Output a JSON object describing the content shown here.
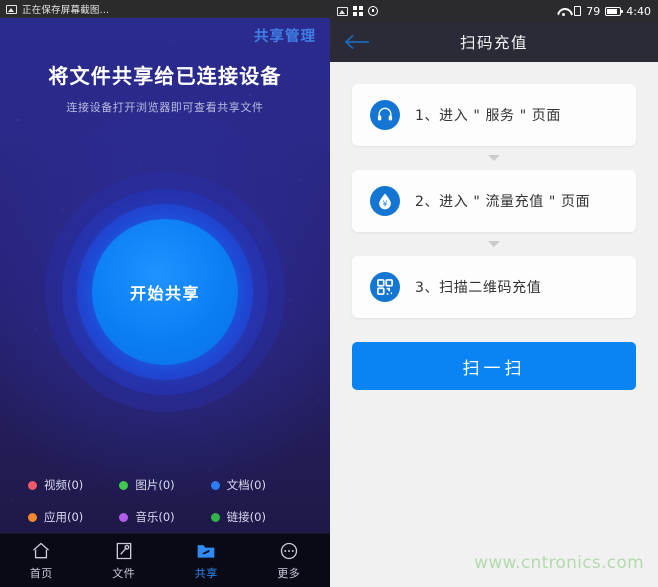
{
  "left": {
    "statusbar": {
      "icon": "image-icon",
      "text": "正在保存屏幕截图..."
    },
    "header": {
      "manage_label": "共享管理"
    },
    "title": "将文件共享给已连接设备",
    "subtitle": "连接设备打开浏览器即可查看共享文件",
    "circle": {
      "label": "开始共享",
      "color": "#0b7ef5"
    },
    "legend": [
      {
        "label": "视频(0)",
        "color": "#ef5a6a"
      },
      {
        "label": "图片(0)",
        "color": "#3fc94f"
      },
      {
        "label": "文档(0)",
        "color": "#2b7cf3"
      },
      {
        "label": "应用(0)",
        "color": "#f2882b"
      },
      {
        "label": "音乐(0)",
        "color": "#b25ce8"
      },
      {
        "label": "链接(0)",
        "color": "#2fb34a"
      }
    ],
    "nav": [
      {
        "label": "首页",
        "icon": "home-icon",
        "active": false
      },
      {
        "label": "文件",
        "icon": "file-icon",
        "active": false
      },
      {
        "label": "共享",
        "icon": "share-folder-icon",
        "active": true
      },
      {
        "label": "更多",
        "icon": "more-icon",
        "active": false
      }
    ]
  },
  "right": {
    "statusbar": {
      "left_icons": [
        "image-icon",
        "grid-icon",
        "clock-icon"
      ],
      "signal_value": "79",
      "time": "4:40",
      "right_icons": [
        "wifi-icon",
        "sim-icon",
        "battery-icon"
      ]
    },
    "header": {
      "back": "back-arrow-icon",
      "title": "扫码充值"
    },
    "steps": [
      {
        "icon": "service-headset-icon",
        "text": "1、进入 \" 服务 \" 页面"
      },
      {
        "icon": "water-drop-yuan-icon",
        "text": "2、进入 \" 流量充值 \" 页面"
      },
      {
        "icon": "qrcode-icon",
        "text": "3、扫描二维码充值"
      }
    ],
    "scan_button": {
      "label": "扫一扫",
      "color": "#0a84f2"
    }
  },
  "watermark": "www.cntronics.com"
}
